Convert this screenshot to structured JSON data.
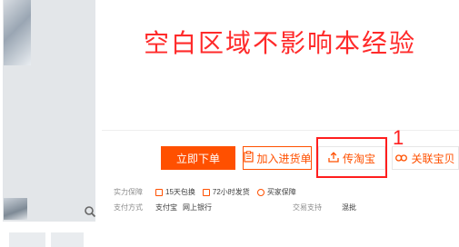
{
  "overlay": {
    "title": "空白区域不影响本经验",
    "step_number": "1"
  },
  "actions": {
    "buy_now": "立即下单",
    "add_to_stock": "加入进货单",
    "share": "传淘宝",
    "link_item": "关联宝贝"
  },
  "service": {
    "label": "实力保障",
    "items": [
      "15天包换",
      "72小时发货",
      "买家保障"
    ]
  },
  "payment": {
    "label": "支付方式",
    "methods": [
      "支付宝",
      "网上银行"
    ]
  },
  "trade": {
    "label": "交易支持",
    "value": "混批"
  },
  "colors": {
    "accent": "#ff5000",
    "annotation": "#ff1e1e"
  },
  "icons": [
    "search-icon",
    "clipboard-icon",
    "upload-icon",
    "link-icon",
    "shield-icon",
    "truck-icon",
    "guarantee-icon"
  ]
}
